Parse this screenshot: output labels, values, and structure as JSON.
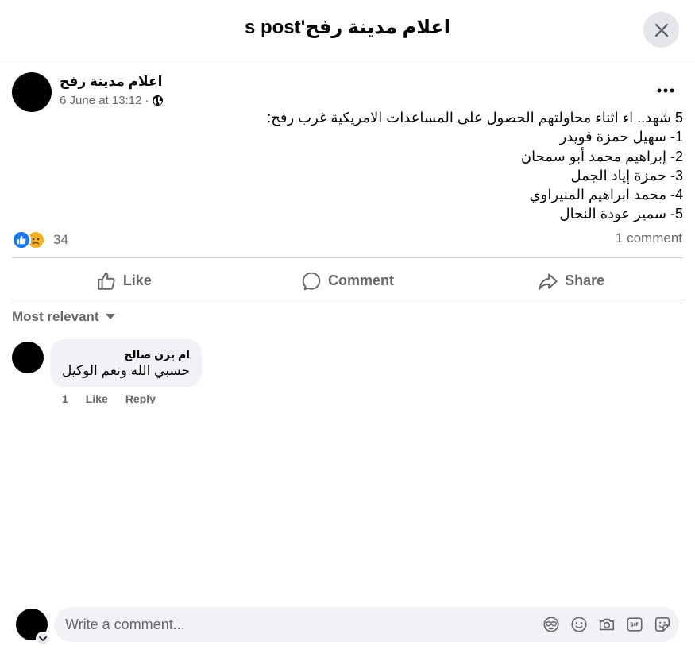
{
  "dialog": {
    "title": "اعلام مدينة رفح's post"
  },
  "post": {
    "author": "اعلام مدينة رفح",
    "date": "6 June at 13:12",
    "separator": "·",
    "privacy_icon": "globe-icon",
    "lines": [
      "5 شهد.. اء اثناء محاولتهم الحصول على المساعدات الامريكية غرب رفح:",
      "1- سهيل حمزة قويدر",
      "2- إبراهيم محمد أبو سمحان",
      "3- حمزة إياد الجمل",
      "4- محمد ابراهيم المنيراوي",
      "5- سمير عودة النحال"
    ],
    "reaction_icons": [
      "like-reaction-icon",
      "sad-reaction-icon"
    ],
    "reaction_count": "34",
    "comment_count": "1 comment"
  },
  "actions": {
    "like": "Like",
    "comment": "Comment",
    "share": "Share"
  },
  "comments_section": {
    "sort_label": "Most relevant",
    "comments": [
      {
        "author": "ام يزن صالح",
        "text": "حسبي الله ونعم الوكيل",
        "time": "1",
        "like": "Like",
        "reply": "Reply"
      }
    ]
  },
  "composer": {
    "placeholder": "Write a comment...",
    "icons": [
      "avatar-sticker-icon",
      "emoji-icon",
      "camera-icon",
      "gif-icon",
      "sticker-icon"
    ]
  },
  "colors": {
    "accent": "#1877f2",
    "secondary_text": "#65676b",
    "bubble_bg": "#f0f2f5"
  }
}
